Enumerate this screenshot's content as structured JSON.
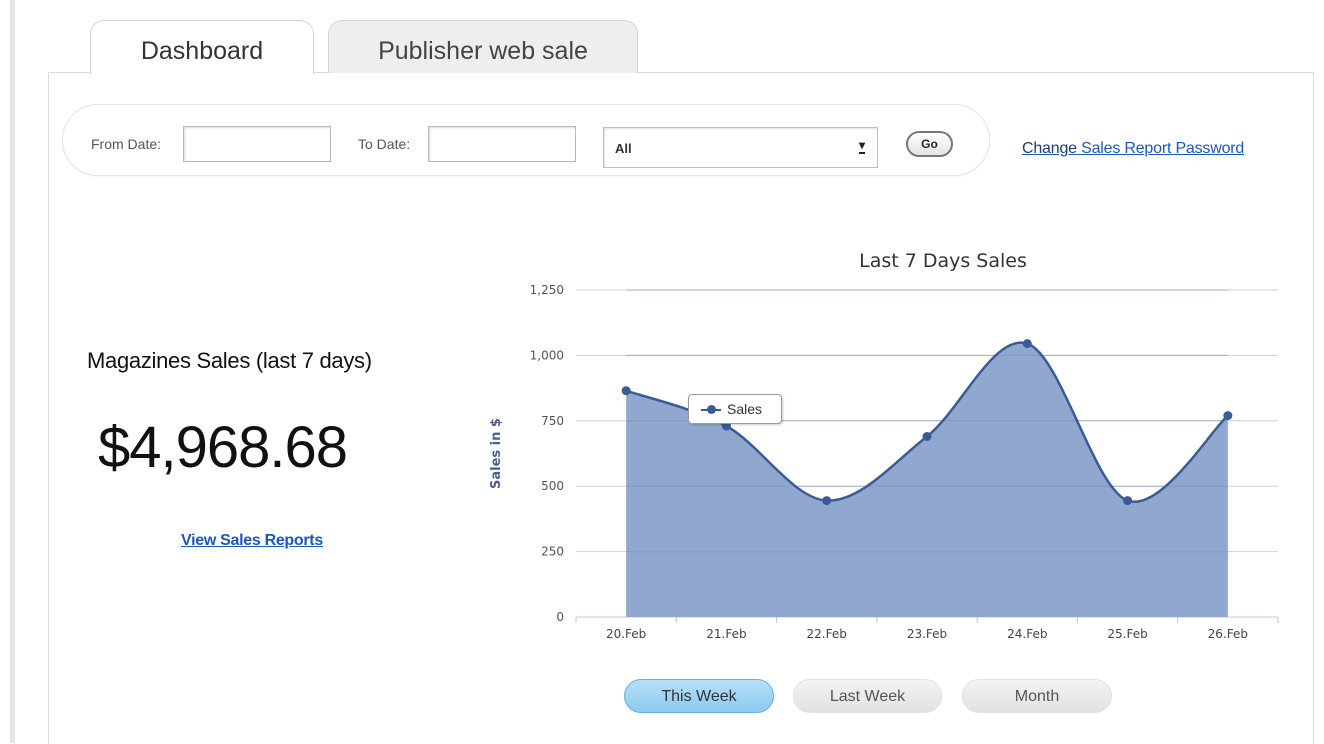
{
  "tabs": [
    {
      "label": "Dashboard",
      "active": true
    },
    {
      "label": "Publisher web sale",
      "active": false
    }
  ],
  "filters": {
    "from_label": "From Date:",
    "from_value": "",
    "to_label": "To Date:",
    "to_value": "",
    "select_value": "All",
    "go_label": "Go"
  },
  "password_link": {
    "part1": "Change",
    "part2": "Sales Report Password"
  },
  "summary": {
    "title": "Magazines Sales (last 7 days)",
    "amount": "$4,968.68",
    "report_link": "View Sales Reports"
  },
  "range_buttons": [
    "This Week",
    "Last Week",
    "Month"
  ],
  "colors": {
    "series_fill": "#8aa3cc",
    "series_line": "#3b5b96",
    "accent": "#1f57b8"
  },
  "chart_data": {
    "type": "area",
    "title": "Last 7 Days Sales",
    "ylabel": "Sales in $",
    "xlabel": "",
    "categories": [
      "20.Feb",
      "21.Feb",
      "22.Feb",
      "23.Feb",
      "24.Feb",
      "25.Feb",
      "26.Feb"
    ],
    "series": [
      {
        "name": "Sales",
        "values": [
          865,
          730,
          445,
          690,
          1045,
          445,
          770
        ]
      }
    ],
    "ylim": [
      0,
      1250
    ],
    "yticks": [
      0,
      250,
      500,
      750,
      1000,
      1250
    ],
    "ytick_labels": [
      "0",
      "250",
      "500",
      "750",
      "1,000",
      "1,250"
    ],
    "grid": true,
    "legend": "inside-top-left"
  }
}
